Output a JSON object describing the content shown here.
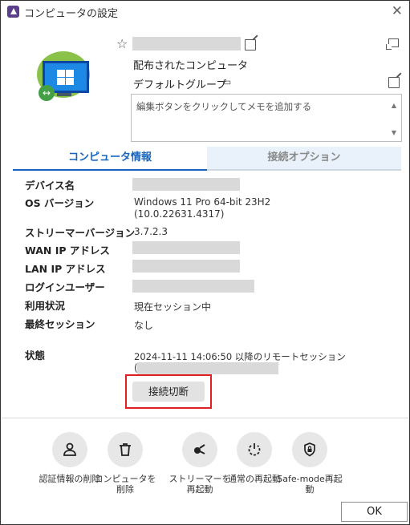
{
  "window": {
    "title": "コンピュータの設定",
    "close_glyph": "✕"
  },
  "header": {
    "star_glyph": "☆",
    "distributed_label": "配布されたコンピュータ",
    "group_label": "デフォルトグループ",
    "memo_placeholder": "編集ボタンをクリックしてメモを追加する"
  },
  "tabs": [
    {
      "label": "コンピュータ情報",
      "active": true
    },
    {
      "label": "接続オプション",
      "active": false
    }
  ],
  "info": {
    "device_name_label": "デバイス名",
    "os_version_label": "OS バージョン",
    "os_version_line1": "Windows 11 Pro 64-bit 23H2",
    "os_version_line2": "(10.0.22631.4317)",
    "streamer_version_label": "ストリーマーバージョン",
    "streamer_version_value": "3.7.2.3",
    "wan_ip_label": "WAN IP アドレス",
    "lan_ip_label": "LAN IP アドレス",
    "login_user_label": "ログインユーザー",
    "usage_label": "利用状況",
    "usage_value": "現在セッション中",
    "last_session_label": "最終セッション",
    "last_session_value": "なし",
    "state_label": "状態",
    "state_value": "2024-11-11 14:06:50 以降のリモートセッション",
    "state_paren": "("
  },
  "disconnect_button": "接続切断",
  "actions": [
    {
      "icon": "person-icon",
      "label": "認証情報の削除"
    },
    {
      "icon": "trash-icon",
      "label": "コンピュータを削除"
    },
    {
      "icon": "streamer-icon",
      "label": "ストリーマーを再起動"
    },
    {
      "icon": "power-icon",
      "label": "通常の再起動"
    },
    {
      "icon": "shield-lock-icon",
      "label": "Safe-mode再起動"
    }
  ],
  "ok_button": "OK",
  "colors": {
    "accent": "#1565c0",
    "highlight_border": "#e02020",
    "device_green": "#8bc34a",
    "screen_blue": "#1e88e5"
  }
}
